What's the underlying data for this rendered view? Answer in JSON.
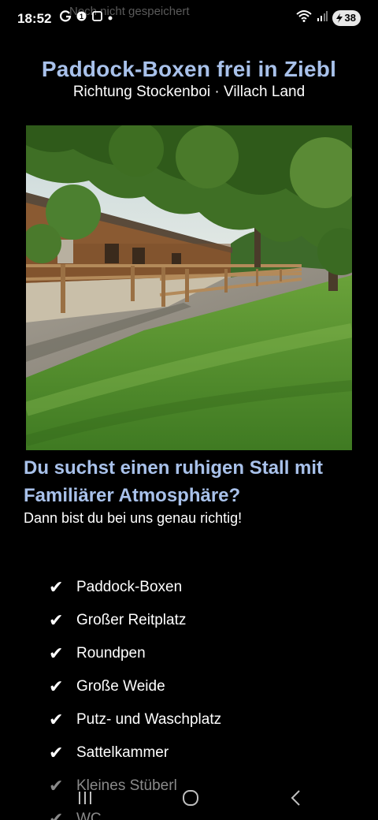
{
  "status_bar": {
    "time": "18:52",
    "notification_ghost_text": "Noch nicht gespeichert",
    "battery": "38",
    "left_icons": [
      "g-notification-icon",
      "signal-app-icon",
      "screen-icon",
      "dot-icon"
    ],
    "right_icons": [
      "wifi-icon",
      "cell-signal-icon",
      "battery-icon"
    ]
  },
  "header": {
    "title": "Paddock-Boxen frei in Ziebl",
    "subtitle": "Richtung Stockenboi · Villach Land"
  },
  "photo": {
    "subject": "paddock-stable-photo"
  },
  "intro": {
    "headline": "Du suchst einen ruhigen Stall mit Familiärer Atmosphäre?",
    "lead": "Dann bist du bei uns genau richtig!"
  },
  "features": {
    "check_symbol": "✔",
    "items": [
      "Paddock-Boxen",
      "Großer Reitplatz",
      "Roundpen",
      "Große Weide",
      "Putz- und Waschplatz",
      "Sattelkammer",
      "Kleines Stüberl",
      "WC"
    ]
  },
  "navbar": {
    "recents_icon": "recents-icon",
    "home_icon": "home-icon",
    "back_icon": "back-icon"
  },
  "colors": {
    "accent": "#a8c1ea",
    "background": "#000000",
    "text": "#ffffff"
  }
}
